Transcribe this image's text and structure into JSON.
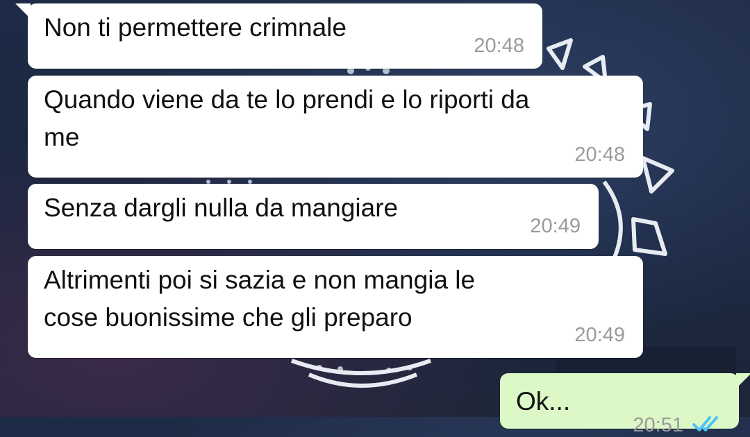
{
  "colors": {
    "incoming_bubble": "#ffffff",
    "outgoing_bubble": "#dcf8c6",
    "timestamp": "#9a9a9a",
    "read_ticks": "#4fc3f7",
    "wallpaper": "#1e2b46"
  },
  "messages": [
    {
      "text": "Non ti permettere crimnale",
      "time": "20:48",
      "direction": "incoming"
    },
    {
      "text": "Quando viene da te lo prendi e lo riporti da\nme",
      "time": "20:48",
      "direction": "incoming"
    },
    {
      "text": "Senza dargli nulla da mangiare",
      "time": "20:49",
      "direction": "incoming"
    },
    {
      "text": "Altrimenti poi si sazia e non mangia le\ncose buonissime che gli preparo",
      "time": "20:49",
      "direction": "incoming"
    },
    {
      "text": "Ok...",
      "time": "20:51",
      "direction": "outgoing",
      "status_icon": "double-check-read-icon"
    }
  ]
}
